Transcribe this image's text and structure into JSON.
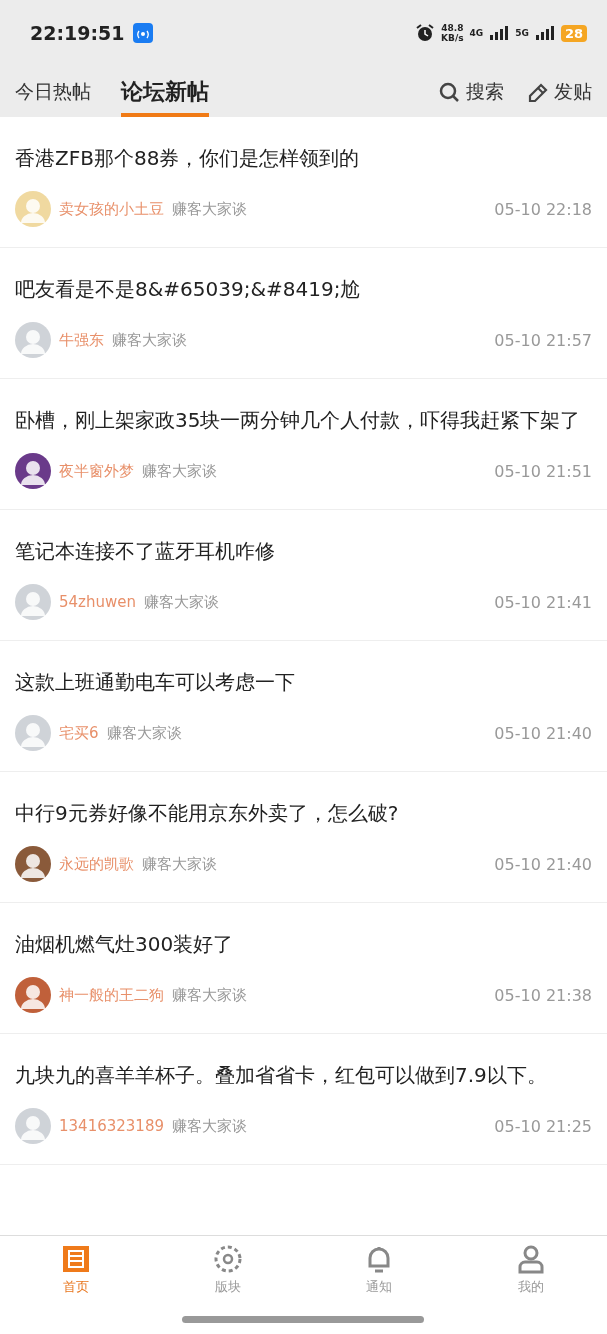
{
  "status_bar": {
    "time": "22:19:51",
    "net_speed": "48.8",
    "net_unit": "KB/s",
    "signal_1": "4G",
    "signal_2": "5G",
    "battery": "28"
  },
  "tabs": [
    {
      "label": "今日热帖",
      "selected": false
    },
    {
      "label": "论坛新帖",
      "selected": true
    }
  ],
  "actions": [
    {
      "kind": "search",
      "label": "搜索"
    },
    {
      "kind": "post",
      "label": "发贴"
    }
  ],
  "posts": [
    {
      "title": "香港ZFB那个88券，你们是怎样领到的",
      "author": "卖女孩的小土豆",
      "forum": "赚客大家谈",
      "time": "05-10 22:18",
      "color": "#f0d9a0"
    },
    {
      "title": "吧友看是不是8&#65039;&#8419;尬",
      "author": "牛强东",
      "forum": "赚客大家谈",
      "time": "05-10 21:57",
      "color": "#cfd3d8"
    },
    {
      "title": "卧槽，刚上架家政35块一两分钟几个人付款，吓得我赶紧下架了",
      "author": "夜半窗外梦",
      "forum": "赚客大家谈",
      "time": "05-10 21:51",
      "color": "#6a3a8a"
    },
    {
      "title": "笔记本连接不了蓝牙耳机咋修",
      "author": "54zhuwen",
      "forum": "赚客大家谈",
      "time": "05-10 21:41",
      "color": "#cfd3d8"
    },
    {
      "title": "这款上班通勤电车可以考虑一下",
      "author": "宅买6",
      "forum": "赚客大家谈",
      "time": "05-10 21:40",
      "color": "#cfd3d8"
    },
    {
      "title": "中行9元券好像不能用京东外卖了，怎么破?",
      "author": "永远的凯歌",
      "forum": "赚客大家谈",
      "time": "05-10 21:40",
      "color": "#8a5a3a"
    },
    {
      "title": "油烟机燃气灶300装好了",
      "author": "神一般的王二狗",
      "forum": "赚客大家谈",
      "time": "05-10 21:38",
      "color": "#c0603a"
    },
    {
      "title": "九块九的喜羊羊杯子。叠加省省卡，红包可以做到7.9以下。",
      "author": "13416323189",
      "forum": "赚客大家谈",
      "time": "05-10 21:25",
      "color": "#cfd3d8"
    }
  ],
  "bottom_nav": [
    {
      "kind": "home",
      "label": "首页",
      "selected": true
    },
    {
      "kind": "sections",
      "label": "版块",
      "selected": false
    },
    {
      "kind": "notify",
      "label": "通知",
      "selected": false
    },
    {
      "kind": "me",
      "label": "我的",
      "selected": false
    }
  ]
}
